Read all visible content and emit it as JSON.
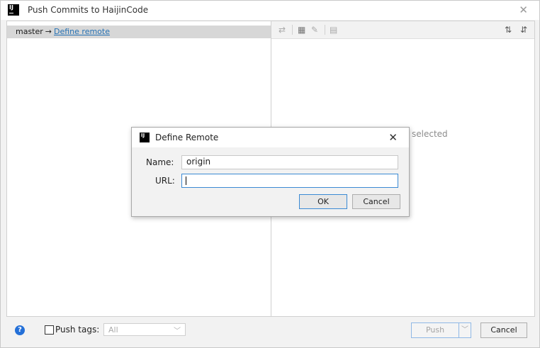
{
  "window": {
    "title": "Push Commits to HaijinCode",
    "app_icon_text": "IJ"
  },
  "left_pane": {
    "branch": "master",
    "arrow": "→",
    "remote_link": "Define remote"
  },
  "right_pane": {
    "toolbar_icons": [
      "vcs-fetch-icon",
      "group-by-icon",
      "edit-icon",
      "preview-icon",
      "expand-all-icon",
      "collapse-all-icon"
    ],
    "placeholder_text": "selected"
  },
  "bottom_bar": {
    "help_label": "?",
    "push_tags_label": "Push tags:",
    "push_tags_value": "All",
    "push_button": "Push",
    "cancel_button": "Cancel"
  },
  "dialog": {
    "title": "Define Remote",
    "name_label": "Name:",
    "name_value": "origin",
    "url_label": "URL:",
    "url_value": "",
    "ok_button": "OK",
    "cancel_button": "Cancel"
  },
  "colors": {
    "accent": "#3b8ad4",
    "link": "#2470b3",
    "help_icon": "#2470d8"
  }
}
